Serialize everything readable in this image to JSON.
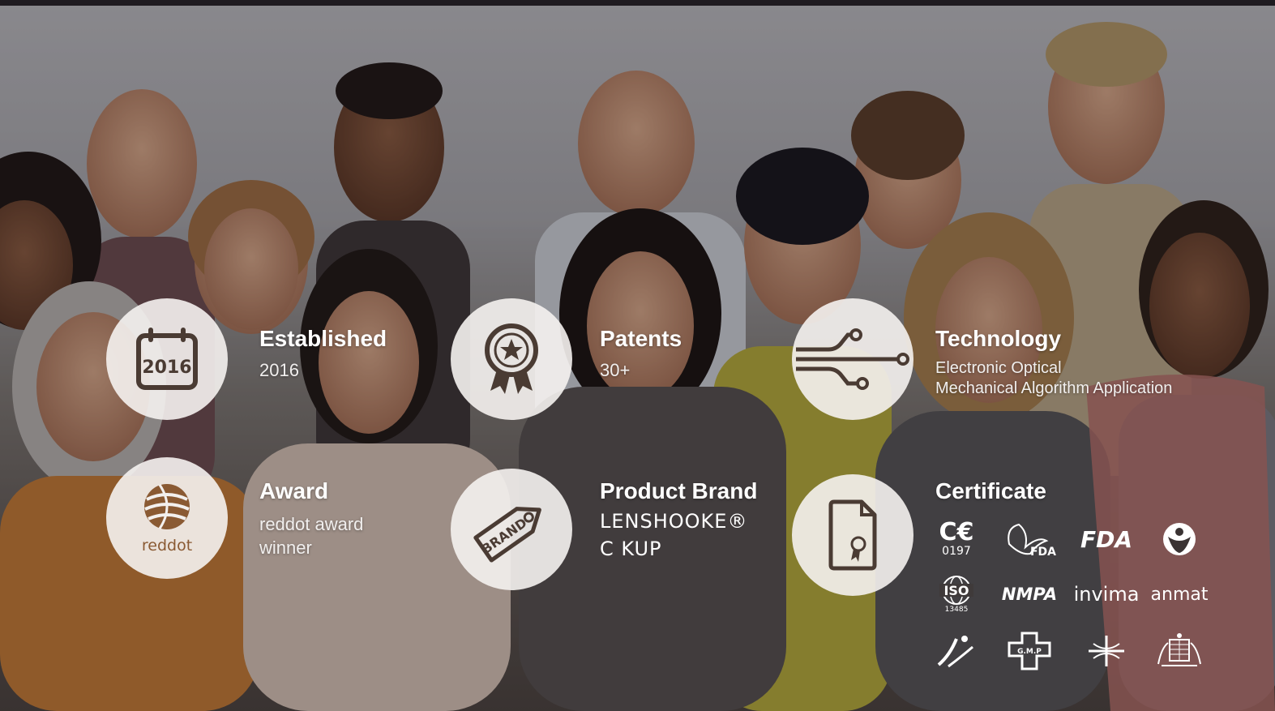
{
  "features": {
    "established": {
      "title": "Established",
      "value": "2016",
      "icon_label": "2016"
    },
    "patents": {
      "title": "Patents",
      "value": "30+"
    },
    "technology": {
      "title": "Technology",
      "line1": "Electronic Optical",
      "line2": "Mechanical Algorithm Application"
    },
    "award": {
      "title": "Award",
      "line1": "reddot award",
      "line2": "winner",
      "icon_label": "reddot"
    },
    "brand": {
      "title": "Product Brand",
      "logo1": "LENSHOOKE®",
      "logo2": "C KUP",
      "icon_label": "BRAND"
    },
    "certificate": {
      "title": "Certificate"
    }
  },
  "certs": {
    "ce": "C€",
    "ce_num": "0197",
    "fda_bird": "FDA",
    "fda": "FDA",
    "iso": "ISO",
    "iso_num": "13485",
    "nmpa": "NMPA",
    "invima": "invima",
    "anmat": "anmat"
  },
  "colors": {
    "icon_brown": "#4a3b33",
    "circle_bg": "#f3f0ee",
    "text": "#ffffff"
  }
}
